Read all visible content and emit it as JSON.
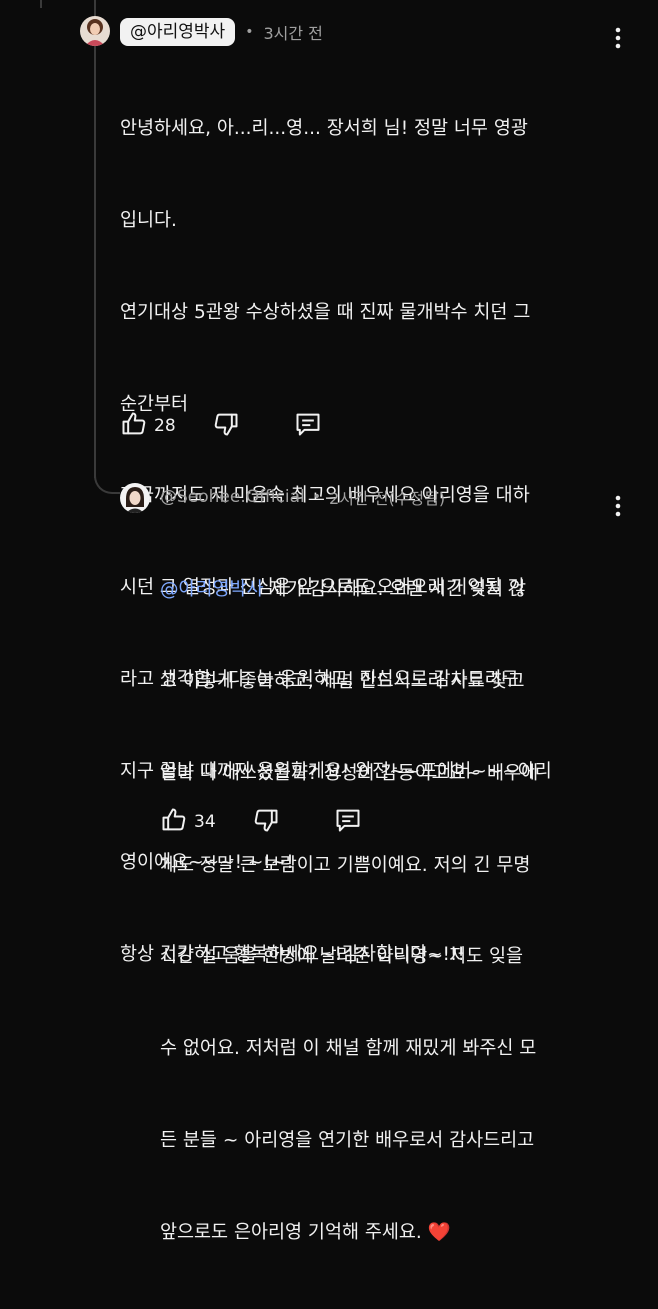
{
  "comment": {
    "author": "@아리영박사",
    "time": "3시간 전",
    "lines": [
      "안녕하세요, 아...리...영... 장서희 님! 정말 너무 영광",
      "입니다.",
      "연기대상 5관왕 수상하셨을 때 진짜 물개박수 치던 그",
      "순간부터",
      "지금까지도 제 마음속 최고의 배우세요.아리영을 대하",
      "시던 그 열정과 진심은 앞 으로도 오래오래 기억될 거",
      "라고 생각합니다. 늘 응원하고, 진심으로 감사드리구",
      "지구 끝날 때까지 응원할게요! 완전~~포에버~~~아리",
      "영이에요~~~! ~!~!",
      "항상 건강하고 행복하세요~!감사합니다~!!!"
    ],
    "likes": "28"
  },
  "reply": {
    "author": "@Seohee.Official",
    "time": "2시간 전(수정됨)",
    "mention": "@아리영박사",
    "lines": [
      " 제가 감사해요. 오랜 시간 잊지 않",
      "고 이렇게 좋아하고, 채널 만드시느라 자료 찾고",
      "얼마 나 애쓰셨을까? 정성이 감동이고요~ 배우에",
      "게도 정말 큰 보람이고 기쁨이예요. 저의 긴 무명",
      "시간 설 움을 한방에 날려준 아리영~ 저도 잊을",
      "수 없어요. 저처럼 이 채널 함께 재밌게 봐주신 모",
      "든 분들 ~ 아리영을 연기한 배우로서 감사드리고",
      "앞으로도 은아리영 기억해 주세요. "
    ],
    "heart": "❤️",
    "likes": "34"
  },
  "icons": {
    "like": "thumbs-up-icon",
    "dislike": "thumbs-down-icon",
    "reply": "reply-icon",
    "more": "more-vert-icon"
  },
  "colors": {
    "background": "#0b0b0b",
    "mention": "#7ea8ff",
    "muted": "#a0a0a0",
    "heart": "#e53935"
  }
}
